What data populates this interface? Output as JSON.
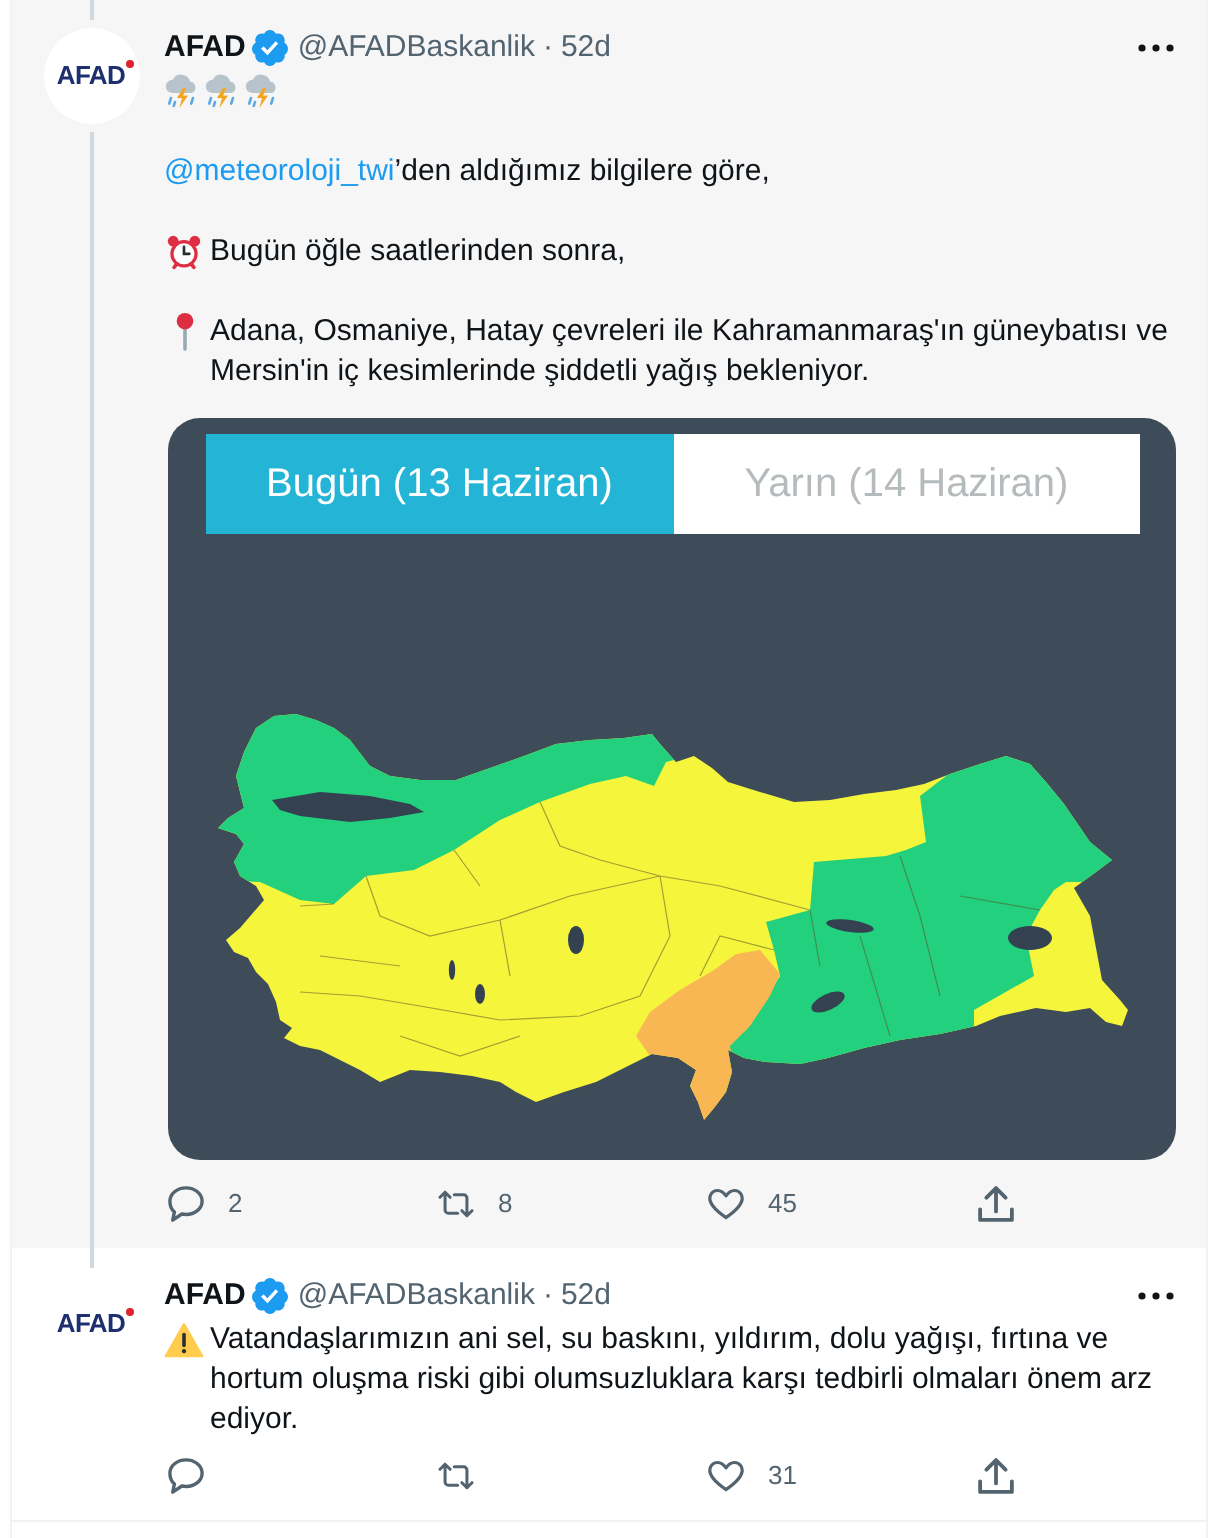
{
  "tweets": [
    {
      "highlighted": true,
      "thread_above": true,
      "thread_below": true,
      "author": {
        "avatar_logo": "AFAD",
        "name": "AFAD",
        "verified": true,
        "handle": "@AFADBaskanlik",
        "separator": "·",
        "time": "52d"
      },
      "paragraphs": [
        {
          "kind": "storms"
        },
        {
          "kind": "mention",
          "mention": "@meteoroloji_twi",
          "text": "’den aldığımız bilgilere göre,"
        },
        {
          "kind": "time",
          "text": "Bugün öğle saatlerinden sonra,"
        },
        {
          "kind": "place",
          "text": "Adana, Osmaniye, Hatay çevreleri ile Kahramanmaraş'ın güneybatısı ve Mersin'in iç kesimlerinde şiddetli yağış bekleniyor."
        }
      ],
      "media": {
        "tabs": [
          {
            "label": "Bugün (13 Haziran)",
            "selected": true
          },
          {
            "label": "Yarın (14 Haziran)",
            "selected": false
          }
        ]
      },
      "actions": [
        {
          "kind": "reply",
          "count": "2"
        },
        {
          "kind": "retweet",
          "count": "8"
        },
        {
          "kind": "like",
          "count": "45"
        },
        {
          "kind": "share"
        }
      ]
    },
    {
      "highlighted": false,
      "thread_above": true,
      "thread_below": false,
      "author": {
        "avatar_logo": "AFAD",
        "name": "AFAD",
        "verified": true,
        "handle": "@AFADBaskanlik",
        "separator": "·",
        "time": "52d"
      },
      "paragraphs": [
        {
          "kind": "warning",
          "text": "Vatandaşlarımızın ani sel, su baskını, yıldırım, dolu yağışı, fırtına ve hortum oluşma riski gibi olumsuzluklara karşı tedbirli olmaları önem arz ediyor."
        }
      ],
      "actions": [
        {
          "kind": "reply"
        },
        {
          "kind": "retweet"
        },
        {
          "kind": "like",
          "count": "31"
        },
        {
          "kind": "share"
        }
      ]
    }
  ]
}
